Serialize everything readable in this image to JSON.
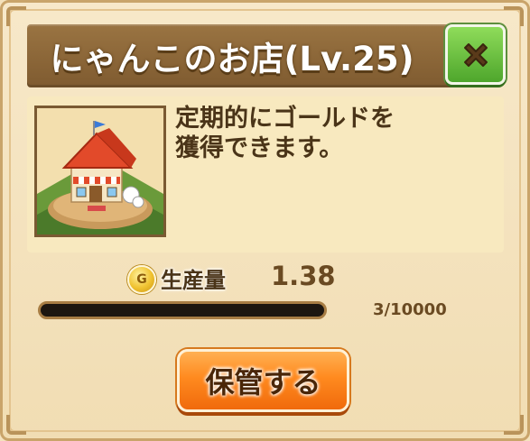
{
  "dialog": {
    "title": "にゃんこのお店(Lv.25)",
    "close_icon": "close-x-icon",
    "description": "定期的にゴールドを\n獲得できます。",
    "thumbnail_icon": "cat-shop-building",
    "production": {
      "coin_glyph": "G",
      "label": "生産量",
      "value": "1.38"
    },
    "progress": {
      "count_text": "3/10000",
      "fraction": 0.0003
    },
    "store_button_label": "保管する",
    "colors": {
      "title_bar": "#8a6438",
      "close_button": "#6cc23e",
      "store_button": "#ff8a1f",
      "panel": "#f8e9bf"
    }
  }
}
